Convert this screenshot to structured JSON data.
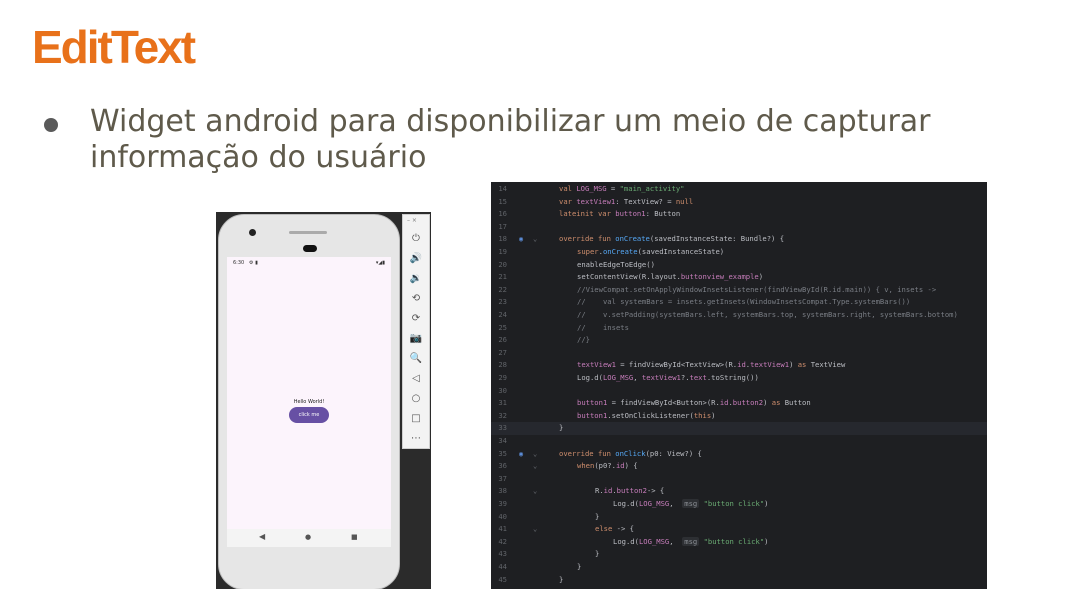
{
  "slide": {
    "title": "EditText",
    "bullet": "Widget android para disponibilizar um meio de capturar informação do usuário"
  },
  "emulator": {
    "time": "6:30",
    "status_icons": "⚙ ▮",
    "signal": "▾◢▮",
    "hello_text": "Hello World!",
    "button_label": "click me",
    "window_controls": "– ×",
    "nav": [
      "◀",
      "●",
      "■"
    ],
    "side_icons": [
      "power-icon",
      "volume-up-icon",
      "volume-down-icon",
      "rotate-left-icon",
      "rotate-right-icon",
      "camera-icon",
      "zoom-icon",
      "back-icon",
      "home-icon",
      "overview-icon",
      "more-icon"
    ],
    "side_glyphs": [
      "⏻",
      "🔊",
      "🔉",
      "⟲",
      "⟳",
      "📷",
      "🔍",
      "◁",
      "○",
      "□",
      "⋯"
    ]
  },
  "code": {
    "colors": {
      "keyword": "#cf8e6d",
      "function": "#56a8f5",
      "string": "#6aab73",
      "comment": "#7a7e85",
      "property": "#c77dbb"
    },
    "lines": [
      {
        "n": "14",
        "indent": 0,
        "t": "val LOG_MSG = \"main_activity\""
      },
      {
        "n": "15",
        "indent": 0,
        "t": "var textView1: TextView? = null"
      },
      {
        "n": "16",
        "indent": 0,
        "t": "lateinit var button1: Button"
      },
      {
        "n": "17",
        "indent": 0,
        "t": ""
      },
      {
        "n": "18",
        "indent": 0,
        "t": "override fun onCreate(savedInstanceState: Bundle?) {"
      },
      {
        "n": "19",
        "indent": 1,
        "t": "super.onCreate(savedInstanceState)"
      },
      {
        "n": "20",
        "indent": 1,
        "t": "enableEdgeToEdge()"
      },
      {
        "n": "21",
        "indent": 1,
        "t": "setContentView(R.layout.buttonview_example)"
      },
      {
        "n": "22",
        "indent": 1,
        "t": "//ViewCompat.setOnApplyWindowInsetsListener(findViewById(R.id.main)) { v, insets ->"
      },
      {
        "n": "23",
        "indent": 1,
        "t": "//    val systemBars = insets.getInsets(WindowInsetsCompat.Type.systemBars())"
      },
      {
        "n": "24",
        "indent": 1,
        "t": "//    v.setPadding(systemBars.left, systemBars.top, systemBars.right, systemBars.bottom)"
      },
      {
        "n": "25",
        "indent": 1,
        "t": "//    insets"
      },
      {
        "n": "26",
        "indent": 1,
        "t": "//}"
      },
      {
        "n": "27",
        "indent": 0,
        "t": ""
      },
      {
        "n": "28",
        "indent": 1,
        "t": "textView1 = findViewById<TextView>(R.id.textView1) as TextView"
      },
      {
        "n": "29",
        "indent": 1,
        "t": "Log.d(LOG_MSG, textView1?.text.toString())"
      },
      {
        "n": "30",
        "indent": 0,
        "t": ""
      },
      {
        "n": "31",
        "indent": 1,
        "t": "button1 = findViewById<Button>(R.id.button2) as Button"
      },
      {
        "n": "32",
        "indent": 1,
        "t": "button1.setOnClickListener(this)"
      },
      {
        "n": "33",
        "indent": 0,
        "t": "}"
      },
      {
        "n": "34",
        "indent": 0,
        "t": ""
      },
      {
        "n": "35",
        "indent": 0,
        "t": "override fun onClick(p0: View?) {"
      },
      {
        "n": "36",
        "indent": 1,
        "t": "when(p0?.id) {"
      },
      {
        "n": "37",
        "indent": 0,
        "t": ""
      },
      {
        "n": "38",
        "indent": 2,
        "t": "R.id.button2-> {"
      },
      {
        "n": "39",
        "indent": 3,
        "t": "Log.d(LOG_MSG,  msg: \"button click\")"
      },
      {
        "n": "40",
        "indent": 2,
        "t": "}"
      },
      {
        "n": "41",
        "indent": 2,
        "t": "else -> {"
      },
      {
        "n": "42",
        "indent": 3,
        "t": "Log.d(LOG_MSG,  msg: \"button click\")"
      },
      {
        "n": "43",
        "indent": 2,
        "t": "}"
      },
      {
        "n": "44",
        "indent": 1,
        "t": "}"
      },
      {
        "n": "45",
        "indent": 0,
        "t": "}"
      }
    ]
  }
}
